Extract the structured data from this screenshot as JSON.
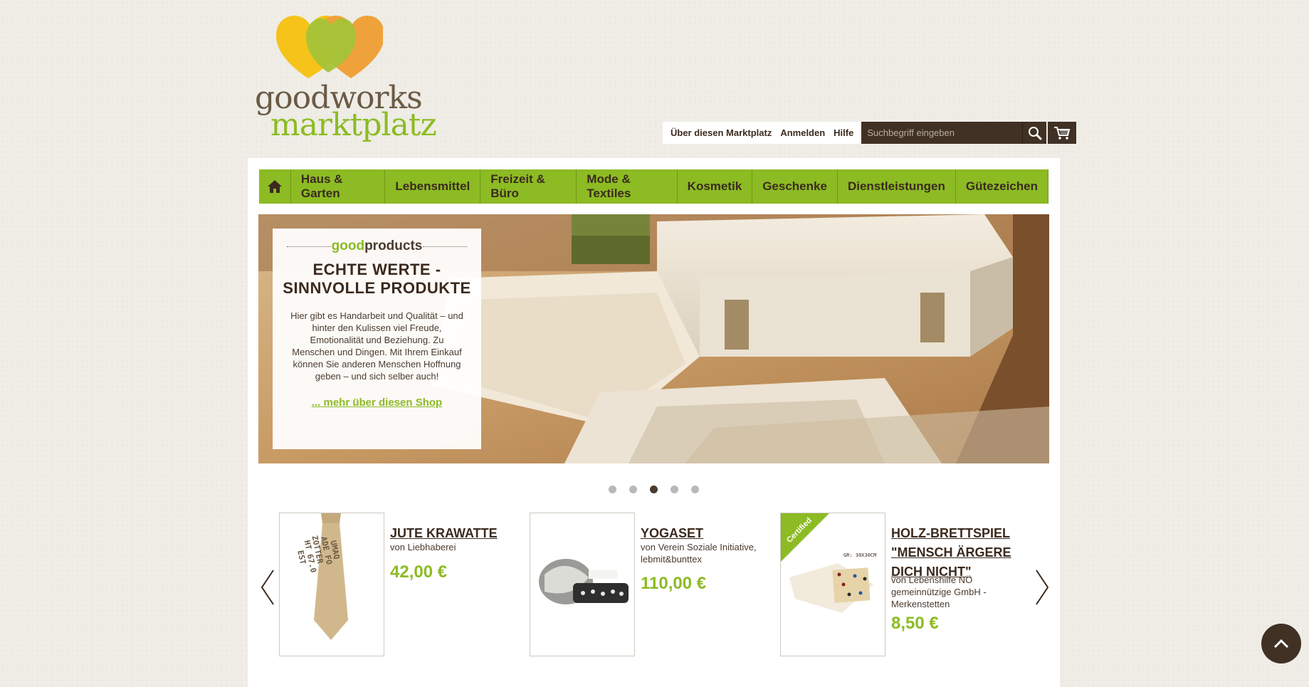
{
  "logo": {
    "line1": "goodworks",
    "line2": "marktplatz"
  },
  "topbar": {
    "links": [
      "Über diesen Marktplatz",
      "Anmelden",
      "Hilfe"
    ],
    "search_placeholder": "Suchbegriff eingeben"
  },
  "nav": {
    "items": [
      "Haus & Garten",
      "Lebensmittel",
      "Freizeit & Büro",
      "Mode & Textiles",
      "Kosmetik",
      "Geschenke",
      "Dienstleistungen",
      "Gütezeichen"
    ]
  },
  "hero": {
    "brand_prefix": "good",
    "brand_suffix": "products",
    "headline": "ECHTE WERTE - SINNVOLLE PRODUKTE",
    "text": "Hier gibt es Handarbeit und Qualität – und hinter den Kulissen viel Freude, Emotionalität und Beziehung. Zu Menschen und Dingen. Mit Ihrem Einkauf können Sie anderen Menschen Hoffnung geben – und sich selber auch!",
    "link": "... mehr über diesen Shop"
  },
  "slider": {
    "count": 5,
    "active": 3
  },
  "products": [
    {
      "title": "JUTE KRAWATTE",
      "vendor": "von Liebhaberei",
      "price": "42,00 €"
    },
    {
      "title": "YOGASET",
      "vendor": "von Verein Soziale Initiative, lebmit&bunttex",
      "price": "110,00 €"
    },
    {
      "title": "HOLZ-BRETTSPIEL \"MENSCH ÄRGERE DICH NICHT\"",
      "vendor": "von Lebenshilfe NÖ gemeinnützige GmbH - Merkenstetten",
      "price": "8,50 €",
      "badge": "Certified",
      "image_label": "GR: 30X30CM"
    }
  ],
  "colors": {
    "accent": "#8cbb23",
    "dark": "#403124",
    "text": "#3b2a1e"
  }
}
